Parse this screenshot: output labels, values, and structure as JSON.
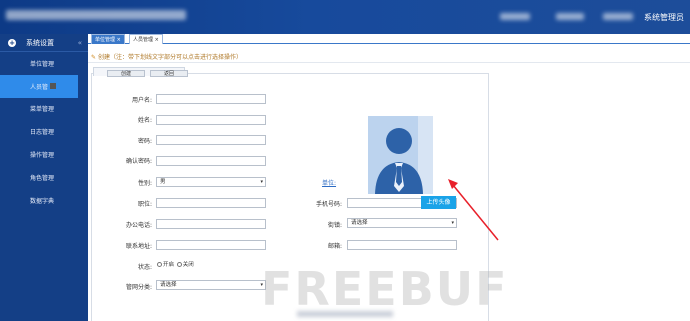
{
  "app": {
    "system_title": "系统管理员"
  },
  "sidebar": {
    "section_title": "系统设置",
    "items": [
      {
        "label": "单位管理"
      },
      {
        "label": "人员管"
      },
      {
        "label": "菜单管理"
      },
      {
        "label": "日志管理"
      },
      {
        "label": "操作管理"
      },
      {
        "label": "角色管理"
      },
      {
        "label": "数据字典"
      }
    ]
  },
  "tabs": [
    {
      "label": "单位管理 ×"
    },
    {
      "label": "人员管理 ×"
    }
  ],
  "page": {
    "title": "创建（注：带下划线文字部分可以点击进行选择操作）",
    "buttons": {
      "create": "创建",
      "back": "返回"
    }
  },
  "form": {
    "username": {
      "label": "用户名:",
      "value": ""
    },
    "name": {
      "label": "姓名:",
      "value": ""
    },
    "password": {
      "label": "密码:",
      "value": ""
    },
    "confirm_password": {
      "label": "确认密码:",
      "value": ""
    },
    "gender": {
      "label": "性别:",
      "selected": "男"
    },
    "unit": {
      "label": "单位:"
    },
    "position": {
      "label": "职位:",
      "value": ""
    },
    "mobile": {
      "label": "手机号码:",
      "value": ""
    },
    "office_phone": {
      "label": "办公电话:",
      "value": ""
    },
    "street": {
      "label": "街镇:",
      "selected": "请选择"
    },
    "address": {
      "label": "联系地址:",
      "value": ""
    },
    "email": {
      "label": "邮箱:",
      "value": ""
    },
    "status": {
      "label": "状态:",
      "options": [
        "开启",
        "关闭"
      ]
    },
    "grid_category": {
      "label": "管网分类:",
      "selected": "请选择"
    },
    "upload_avatar": "上传头像"
  },
  "colors": {
    "topbar": "#174a9c",
    "sidebar": "#143f86",
    "active_item": "#2f8bea",
    "upload_button": "#1aa3e8",
    "annotation_arrow": "#e8202a"
  }
}
